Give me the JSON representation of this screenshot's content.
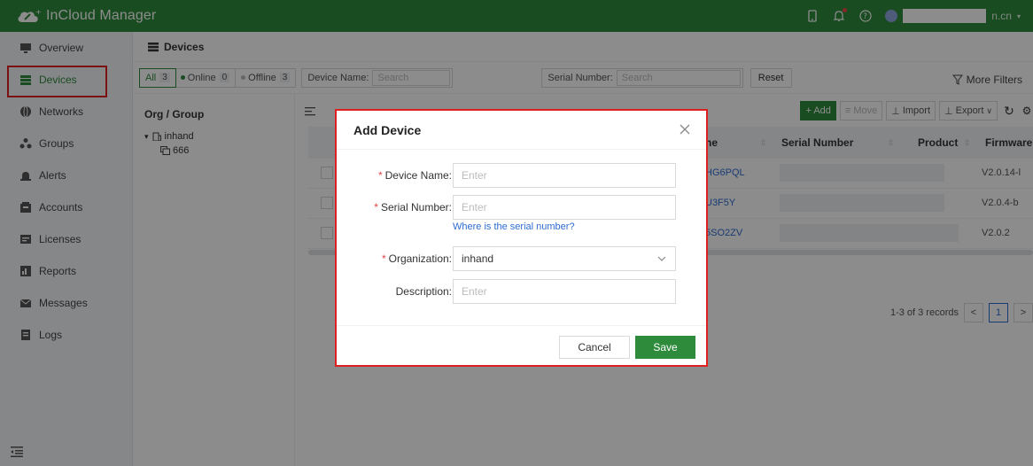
{
  "header": {
    "app_title": "InCloud Manager",
    "user_suffix": "n.cn",
    "colors": {
      "brand": "#2e8b3c",
      "notification": "#f04b4b"
    },
    "icons": [
      "cloud-logo-icon",
      "phone-icon",
      "bell-icon",
      "help-icon",
      "user-avatar-icon",
      "caret-down-icon"
    ]
  },
  "sidebar": {
    "items": [
      {
        "label": "Overview",
        "icon": "monitor-icon",
        "active": false
      },
      {
        "label": "Devices",
        "icon": "devices-icon",
        "active": true
      },
      {
        "label": "Networks",
        "icon": "globe-icon",
        "active": false
      },
      {
        "label": "Groups",
        "icon": "groups-icon",
        "active": false
      },
      {
        "label": "Alerts",
        "icon": "alert-icon",
        "active": false
      },
      {
        "label": "Accounts",
        "icon": "accounts-icon",
        "active": false
      },
      {
        "label": "Licenses",
        "icon": "license-icon",
        "active": false
      },
      {
        "label": "Reports",
        "icon": "reports-icon",
        "active": false
      },
      {
        "label": "Messages",
        "icon": "mail-icon",
        "active": false
      },
      {
        "label": "Logs",
        "icon": "logs-icon",
        "active": false
      }
    ]
  },
  "page": {
    "title": "Devices",
    "filters": {
      "all_label": "All",
      "all_count": "3",
      "online_label": "Online",
      "online_count": "0",
      "offline_label": "Offline",
      "offline_count": "3",
      "device_name_label": "Device Name:",
      "device_name_placeholder": "Search",
      "serial_label": "Serial Number:",
      "serial_placeholder": "Search",
      "reset": "Reset",
      "more_filters": "More Filters"
    },
    "org": {
      "title": "Org / Group",
      "root": "inhand",
      "child": "666"
    },
    "toolbar": {
      "add": "+ Add",
      "move": "Move",
      "import": "Import",
      "export": "Export"
    },
    "table": {
      "columns": {
        "name": "ne",
        "serial": "Serial Number",
        "product": "Product",
        "firmware": "Firmware"
      },
      "rows": [
        {
          "name": "HG6PQL",
          "firmware": "V2.0.14-l"
        },
        {
          "name": "U3F5Y",
          "firmware": "V2.0.4-b"
        },
        {
          "name": "5SO2ZV",
          "firmware": "V2.0.2"
        }
      ]
    },
    "pagination": {
      "summary": "1-3 of 3 records",
      "current": "1",
      "prev": "<",
      "next": ">"
    }
  },
  "modal": {
    "title": "Add Device",
    "fields": {
      "device_name": {
        "label": "Device Name:",
        "placeholder": "Enter"
      },
      "serial_number": {
        "label": "Serial Number:",
        "placeholder": "Enter"
      },
      "organization": {
        "label": "Organization:",
        "value": "inhand"
      },
      "description": {
        "label": "Description:",
        "placeholder": "Enter"
      }
    },
    "help_link": "Where is the serial number?",
    "cancel": "Cancel",
    "save": "Save"
  }
}
